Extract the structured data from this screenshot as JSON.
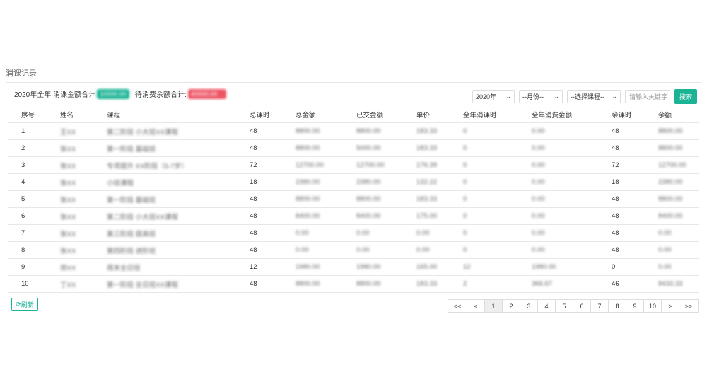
{
  "panel_title": "消课记录",
  "summary": {
    "year_total_label": "2020年全年 消课金额合计",
    "year_total_value": "10000.00",
    "pending_label": "待消费余额合计:",
    "pending_value": "40000.00"
  },
  "filters": {
    "year": "2020年",
    "month": "--月份--",
    "course": "--选择课程--",
    "search_placeholder": "请输入关键字",
    "search_button": "搜索"
  },
  "table": {
    "headers": [
      "序号",
      "姓名",
      "课程",
      "总课时",
      "总金额",
      "已交金额",
      "单价",
      "全年消课时",
      "全年消费金额",
      "余课时",
      "余额"
    ],
    "rows": [
      [
        "1",
        "王XX",
        "第二阶段 小大班XX课程",
        "48",
        "8800.00",
        "8800.00",
        "183.33",
        "0",
        "0.00",
        "48",
        "8800.00"
      ],
      [
        "2",
        "张XX",
        "第一阶段 基础班",
        "48",
        "8800.00",
        "5000.00",
        "183.33",
        "0",
        "0.00",
        "48",
        "8800.00"
      ],
      [
        "3",
        "张XX",
        "专项提升 XX阶段（5-7岁）",
        "72",
        "12700.00",
        "12700.00",
        "176.39",
        "0",
        "0.00",
        "72",
        "12700.00"
      ],
      [
        "4",
        "张XX",
        "小班课程",
        "18",
        "2380.00",
        "2380.00",
        "132.22",
        "0",
        "0.00",
        "18",
        "2380.00"
      ],
      [
        "5",
        "张XX",
        "第一阶段 基础班",
        "48",
        "8800.00",
        "8800.00",
        "183.33",
        "0",
        "0.00",
        "48",
        "8800.00"
      ],
      [
        "6",
        "张XX",
        "第二阶段 小大班XX课程",
        "48",
        "8400.00",
        "8400.00",
        "175.00",
        "0",
        "0.00",
        "48",
        "8400.00"
      ],
      [
        "7",
        "张XX",
        "第三阶段 提高班",
        "48",
        "0.00",
        "0.00",
        "0.00",
        "0",
        "0.00",
        "48",
        "0.00"
      ],
      [
        "8",
        "张XX",
        "第四阶段 进阶班",
        "48",
        "0.00",
        "0.00",
        "0.00",
        "0",
        "0.00",
        "48",
        "0.00"
      ],
      [
        "9",
        "郑XX",
        "周末全日班",
        "12",
        "1980.00",
        "1980.00",
        "165.00",
        "12",
        "1980.00",
        "0",
        "0.00"
      ],
      [
        "10",
        "丁XX",
        "第一阶段 全日班XX课程",
        "48",
        "8800.00",
        "8800.00",
        "183.33",
        "2",
        "366.67",
        "46",
        "8433.33"
      ]
    ]
  },
  "refresh_button": "刷新",
  "pagination": {
    "first": "<<",
    "prev": "<",
    "pages": [
      "1",
      "2",
      "3",
      "4",
      "5",
      "6",
      "7",
      "8",
      "9",
      "10"
    ],
    "next": ">",
    "last": ">>",
    "current": "1"
  }
}
